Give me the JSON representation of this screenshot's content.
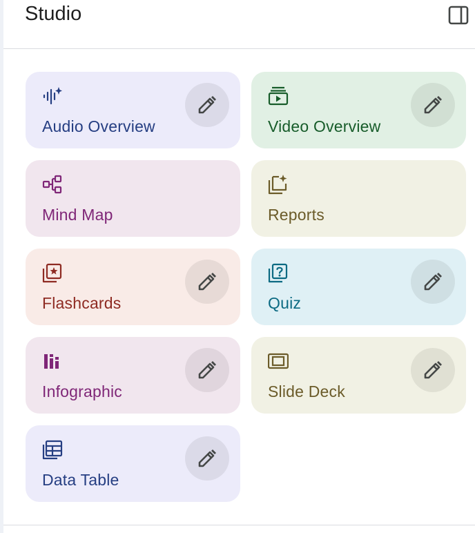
{
  "panel": {
    "title": "Studio",
    "toggle_icon": "side-panel-icon"
  },
  "colors": {
    "audio": {
      "bg": "#ecebfa",
      "fg": "#253e82"
    },
    "video": {
      "bg": "#e1f0e4",
      "fg": "#175c2a"
    },
    "mindmap": {
      "bg": "#f1e6ee",
      "fg": "#7f2677"
    },
    "reports": {
      "bg": "#f1f1e4",
      "fg": "#6b5b29"
    },
    "flashcards": {
      "bg": "#f9ebe7",
      "fg": "#8e2a22"
    },
    "quiz": {
      "bg": "#dff0f5",
      "fg": "#0b6a82"
    },
    "infographic": {
      "bg": "#f1e6ee",
      "fg": "#7f2677"
    },
    "slides": {
      "bg": "#f1f1e4",
      "fg": "#6b5b29"
    },
    "datatable": {
      "bg": "#ecebfa",
      "fg": "#253e82"
    }
  },
  "cards": [
    {
      "key": "audio",
      "label": "Audio Overview",
      "icon": "audio-waveform-icon",
      "editable": true
    },
    {
      "key": "video",
      "label": "Video Overview",
      "icon": "video-icon",
      "editable": true
    },
    {
      "key": "mindmap",
      "label": "Mind Map",
      "icon": "mind-map-icon",
      "editable": false
    },
    {
      "key": "reports",
      "label": "Reports",
      "icon": "reports-icon",
      "editable": false
    },
    {
      "key": "flashcards",
      "label": "Flashcards",
      "icon": "flashcards-icon",
      "editable": true
    },
    {
      "key": "quiz",
      "label": "Quiz",
      "icon": "quiz-icon",
      "editable": true
    },
    {
      "key": "infographic",
      "label": "Infographic",
      "icon": "infographic-icon",
      "editable": true
    },
    {
      "key": "slides",
      "label": "Slide Deck",
      "icon": "slide-deck-icon",
      "editable": true
    },
    {
      "key": "datatable",
      "label": "Data Table",
      "icon": "data-table-icon",
      "editable": true
    }
  ]
}
